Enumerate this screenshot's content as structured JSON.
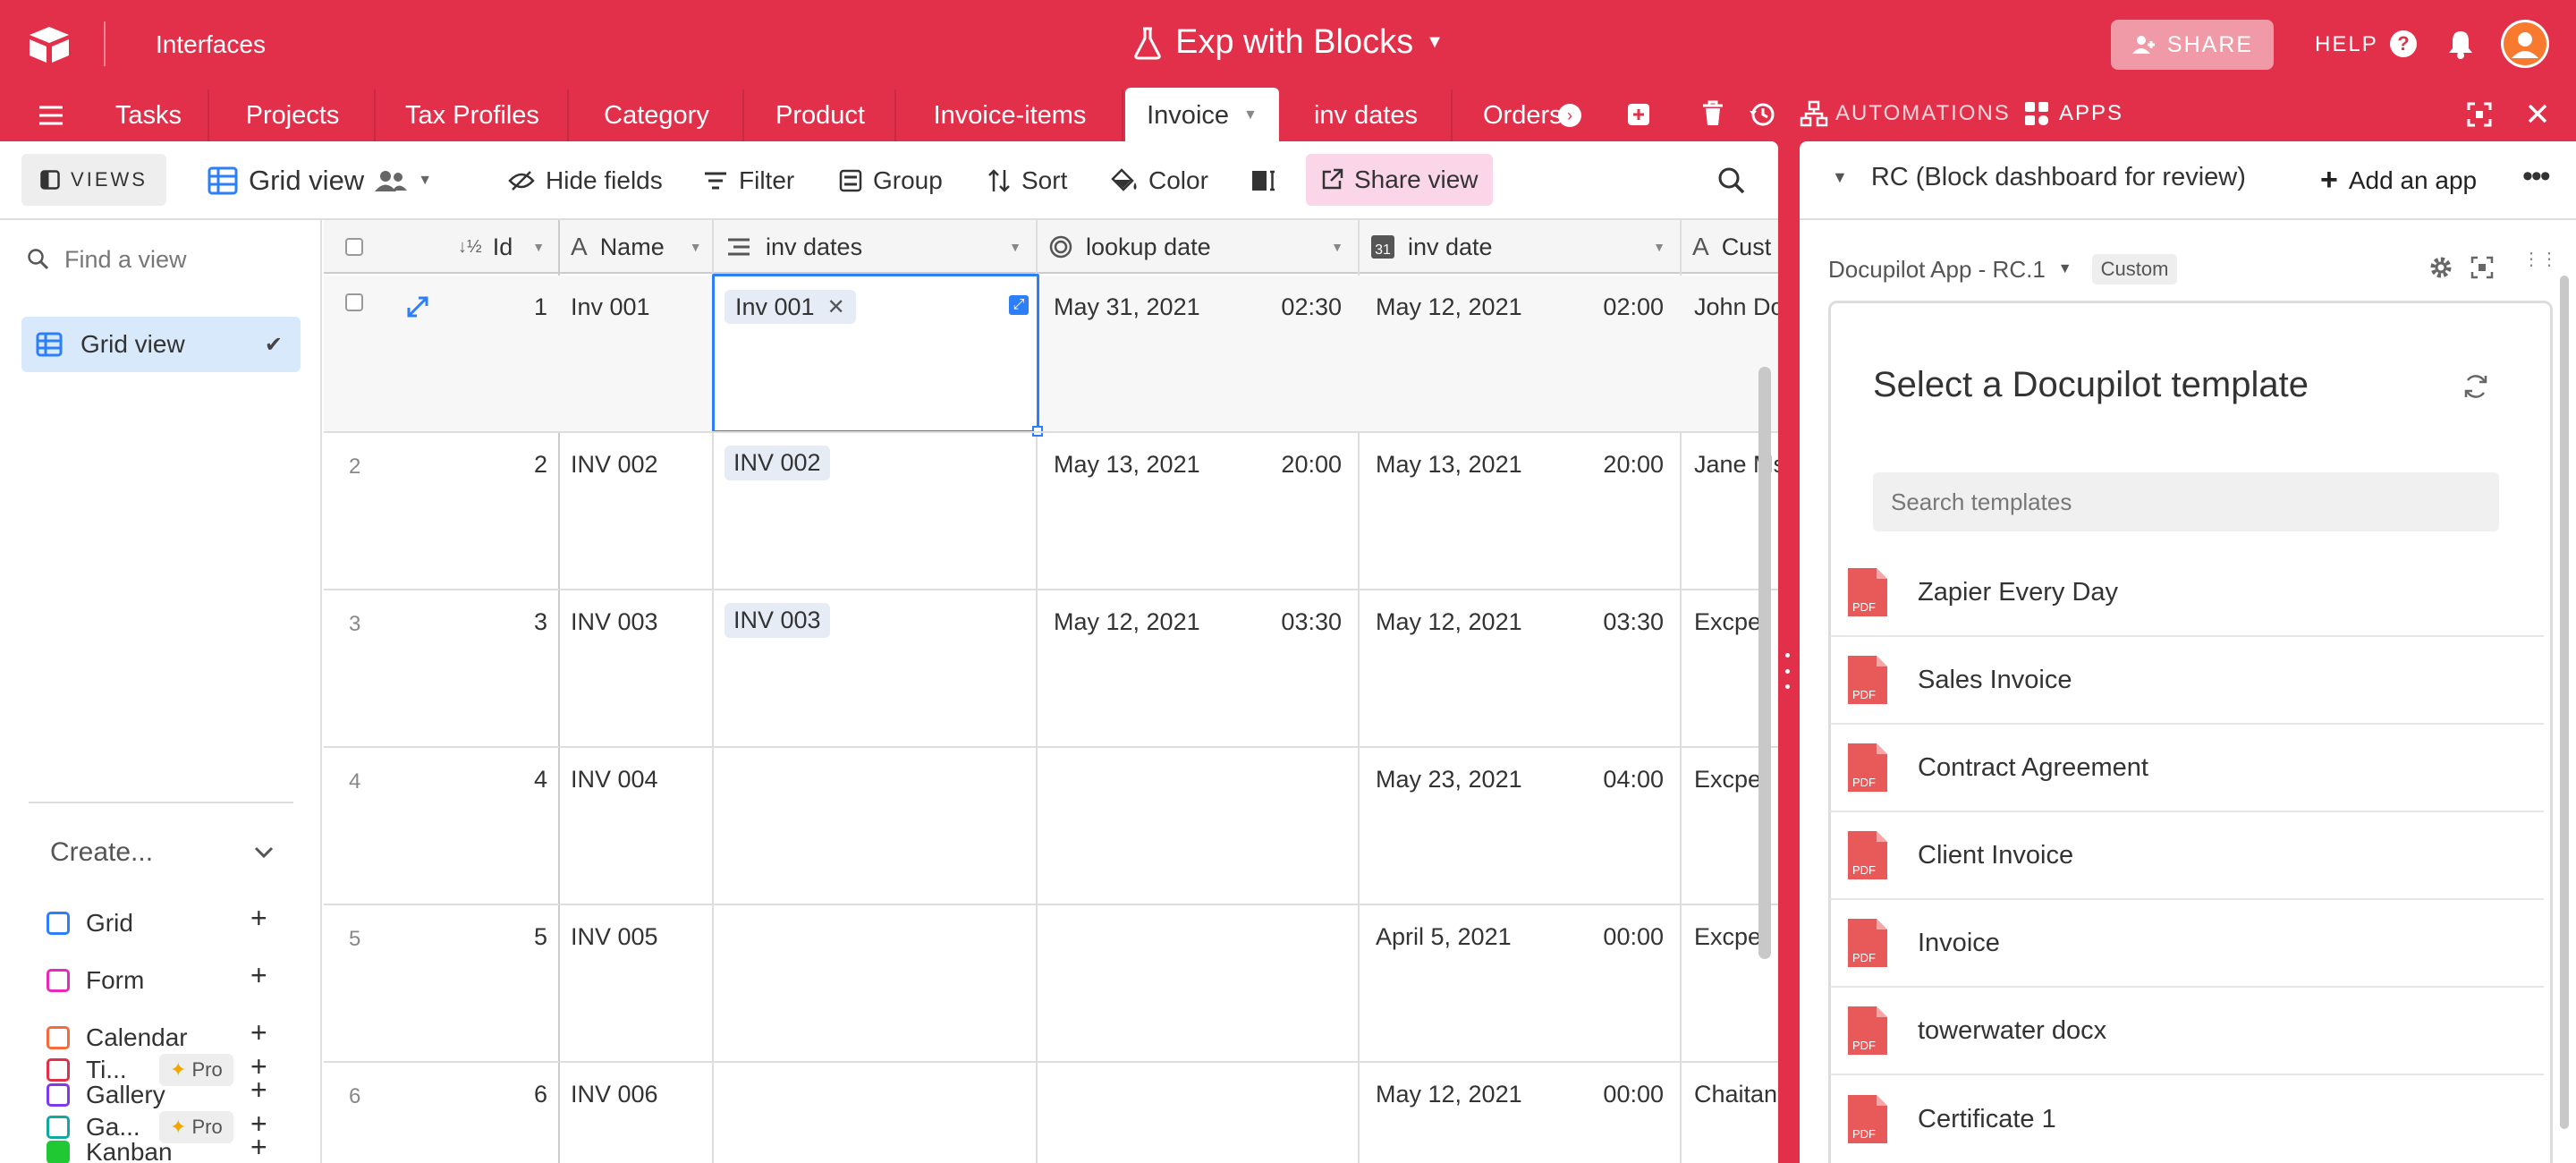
{
  "app": {
    "workspace_label": "Interfaces",
    "base_title": "Exp with Blocks",
    "share_label": "SHARE",
    "help_label": "HELP",
    "automations_label": "AUTOMATIONS",
    "apps_label": "APPS"
  },
  "tabs": [
    "Tasks",
    "Projects",
    "Tax Profiles",
    "Category",
    "Product",
    "Invoice-items",
    "Invoice",
    "inv dates",
    "Orders"
  ],
  "active_tab": "Invoice",
  "toolbar": {
    "views_label": "VIEWS",
    "view_name": "Grid view",
    "hide_fields": "Hide fields",
    "filter": "Filter",
    "group": "Group",
    "sort": "Sort",
    "color": "Color",
    "share_view": "Share view"
  },
  "sidebar": {
    "find_placeholder": "Find a view",
    "current_view": "Grid view",
    "create_label": "Create...",
    "create_items": [
      {
        "label": "Grid",
        "color": "#2d7ff9"
      },
      {
        "label": "Form",
        "color": "#e929ba"
      },
      {
        "label": "Calendar",
        "color": "#f56b3d"
      },
      {
        "label": "Gallery",
        "color": "#7c39ed"
      },
      {
        "label": "Kanban",
        "color": "#20c933"
      },
      {
        "label": "Ti...",
        "color": "#e3304a",
        "pro": "Pro"
      },
      {
        "label": "Ga...",
        "color": "#11a89d",
        "pro": "Pro"
      }
    ]
  },
  "grid": {
    "columns": [
      "Id",
      "Name",
      "inv dates",
      "lookup date",
      "inv date",
      "Cust"
    ],
    "rows": [
      {
        "num": "",
        "id": "1",
        "name": "Inv 001",
        "inv_dates": "Inv 001",
        "lookup_date": "May 31, 2021",
        "lookup_time": "02:30",
        "inv_date": "May 12, 2021",
        "inv_time": "02:00",
        "cust": "John Do"
      },
      {
        "num": "2",
        "id": "2",
        "name": "INV 002",
        "inv_dates": "INV 002",
        "lookup_date": "May 13, 2021",
        "lookup_time": "20:00",
        "inv_date": "May 13, 2021",
        "inv_time": "20:00",
        "cust": "Jane Ms"
      },
      {
        "num": "3",
        "id": "3",
        "name": "INV 003",
        "inv_dates": "INV 003",
        "lookup_date": "May 12, 2021",
        "lookup_time": "03:30",
        "inv_date": "May 12, 2021",
        "inv_time": "03:30",
        "cust": "Excper"
      },
      {
        "num": "4",
        "id": "4",
        "name": "INV 004",
        "inv_dates": "",
        "lookup_date": "",
        "lookup_time": "",
        "inv_date": "May 23, 2021",
        "inv_time": "04:00",
        "cust": "Excper"
      },
      {
        "num": "5",
        "id": "5",
        "name": "INV 005",
        "inv_dates": "",
        "lookup_date": "",
        "lookup_time": "",
        "inv_date": "April 5, 2021",
        "inv_time": "00:00",
        "cust": "Excper"
      },
      {
        "num": "6",
        "id": "6",
        "name": "INV 006",
        "inv_dates": "",
        "lookup_date": "",
        "lookup_time": "",
        "inv_date": "May 12, 2021",
        "inv_time": "00:00",
        "cust": "Chaitan"
      }
    ]
  },
  "dashboard": {
    "title": "RC (Block dashboard for review)",
    "add_app": "Add an app",
    "app_name": "Docupilot App - RC.1",
    "app_badge": "Custom",
    "panel_title": "Select a Docupilot template",
    "search_placeholder": "Search templates",
    "pdf_label": "PDF",
    "templates": [
      "Zapier Every Day",
      "Sales Invoice",
      "Contract Agreement",
      "Client Invoice",
      "Invoice",
      "towerwater docx",
      "Certificate 1"
    ]
  }
}
